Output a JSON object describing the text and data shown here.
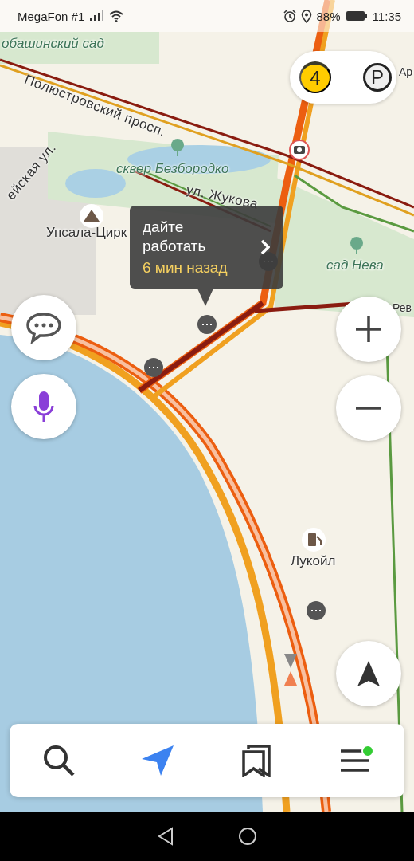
{
  "status_bar": {
    "carrier": "MegaFon #1",
    "battery": "88%",
    "time": "11:35"
  },
  "map": {
    "labels": [
      {
        "text": "обашинский сад",
        "kind": "park"
      },
      {
        "text": "Ар",
        "kind": "place"
      },
      {
        "text": "Полюстровский просп.",
        "kind": "street"
      },
      {
        "text": "ейская ул.",
        "kind": "street"
      },
      {
        "text": "сквер Безбородко",
        "kind": "park"
      },
      {
        "text": "ул. Жукова",
        "kind": "street"
      },
      {
        "text": "Упсала-Цирк",
        "kind": "place"
      },
      {
        "text": "сад Нева",
        "kind": "park"
      },
      {
        "text": "Рев",
        "kind": "place"
      },
      {
        "text": "Лукойл",
        "kind": "place"
      }
    ],
    "traffic": {
      "score": "4"
    },
    "parking": {
      "label": "P"
    },
    "tooltip": {
      "text": "дайте работать",
      "time": "6 мин назад"
    }
  },
  "bottom_nav": [
    {
      "kind": "search",
      "selected": false,
      "notification": false
    },
    {
      "kind": "navigator",
      "selected": true,
      "notification": false
    },
    {
      "kind": "bookmarks",
      "selected": false,
      "notification": false
    },
    {
      "kind": "menu",
      "selected": false,
      "notification": true
    }
  ]
}
